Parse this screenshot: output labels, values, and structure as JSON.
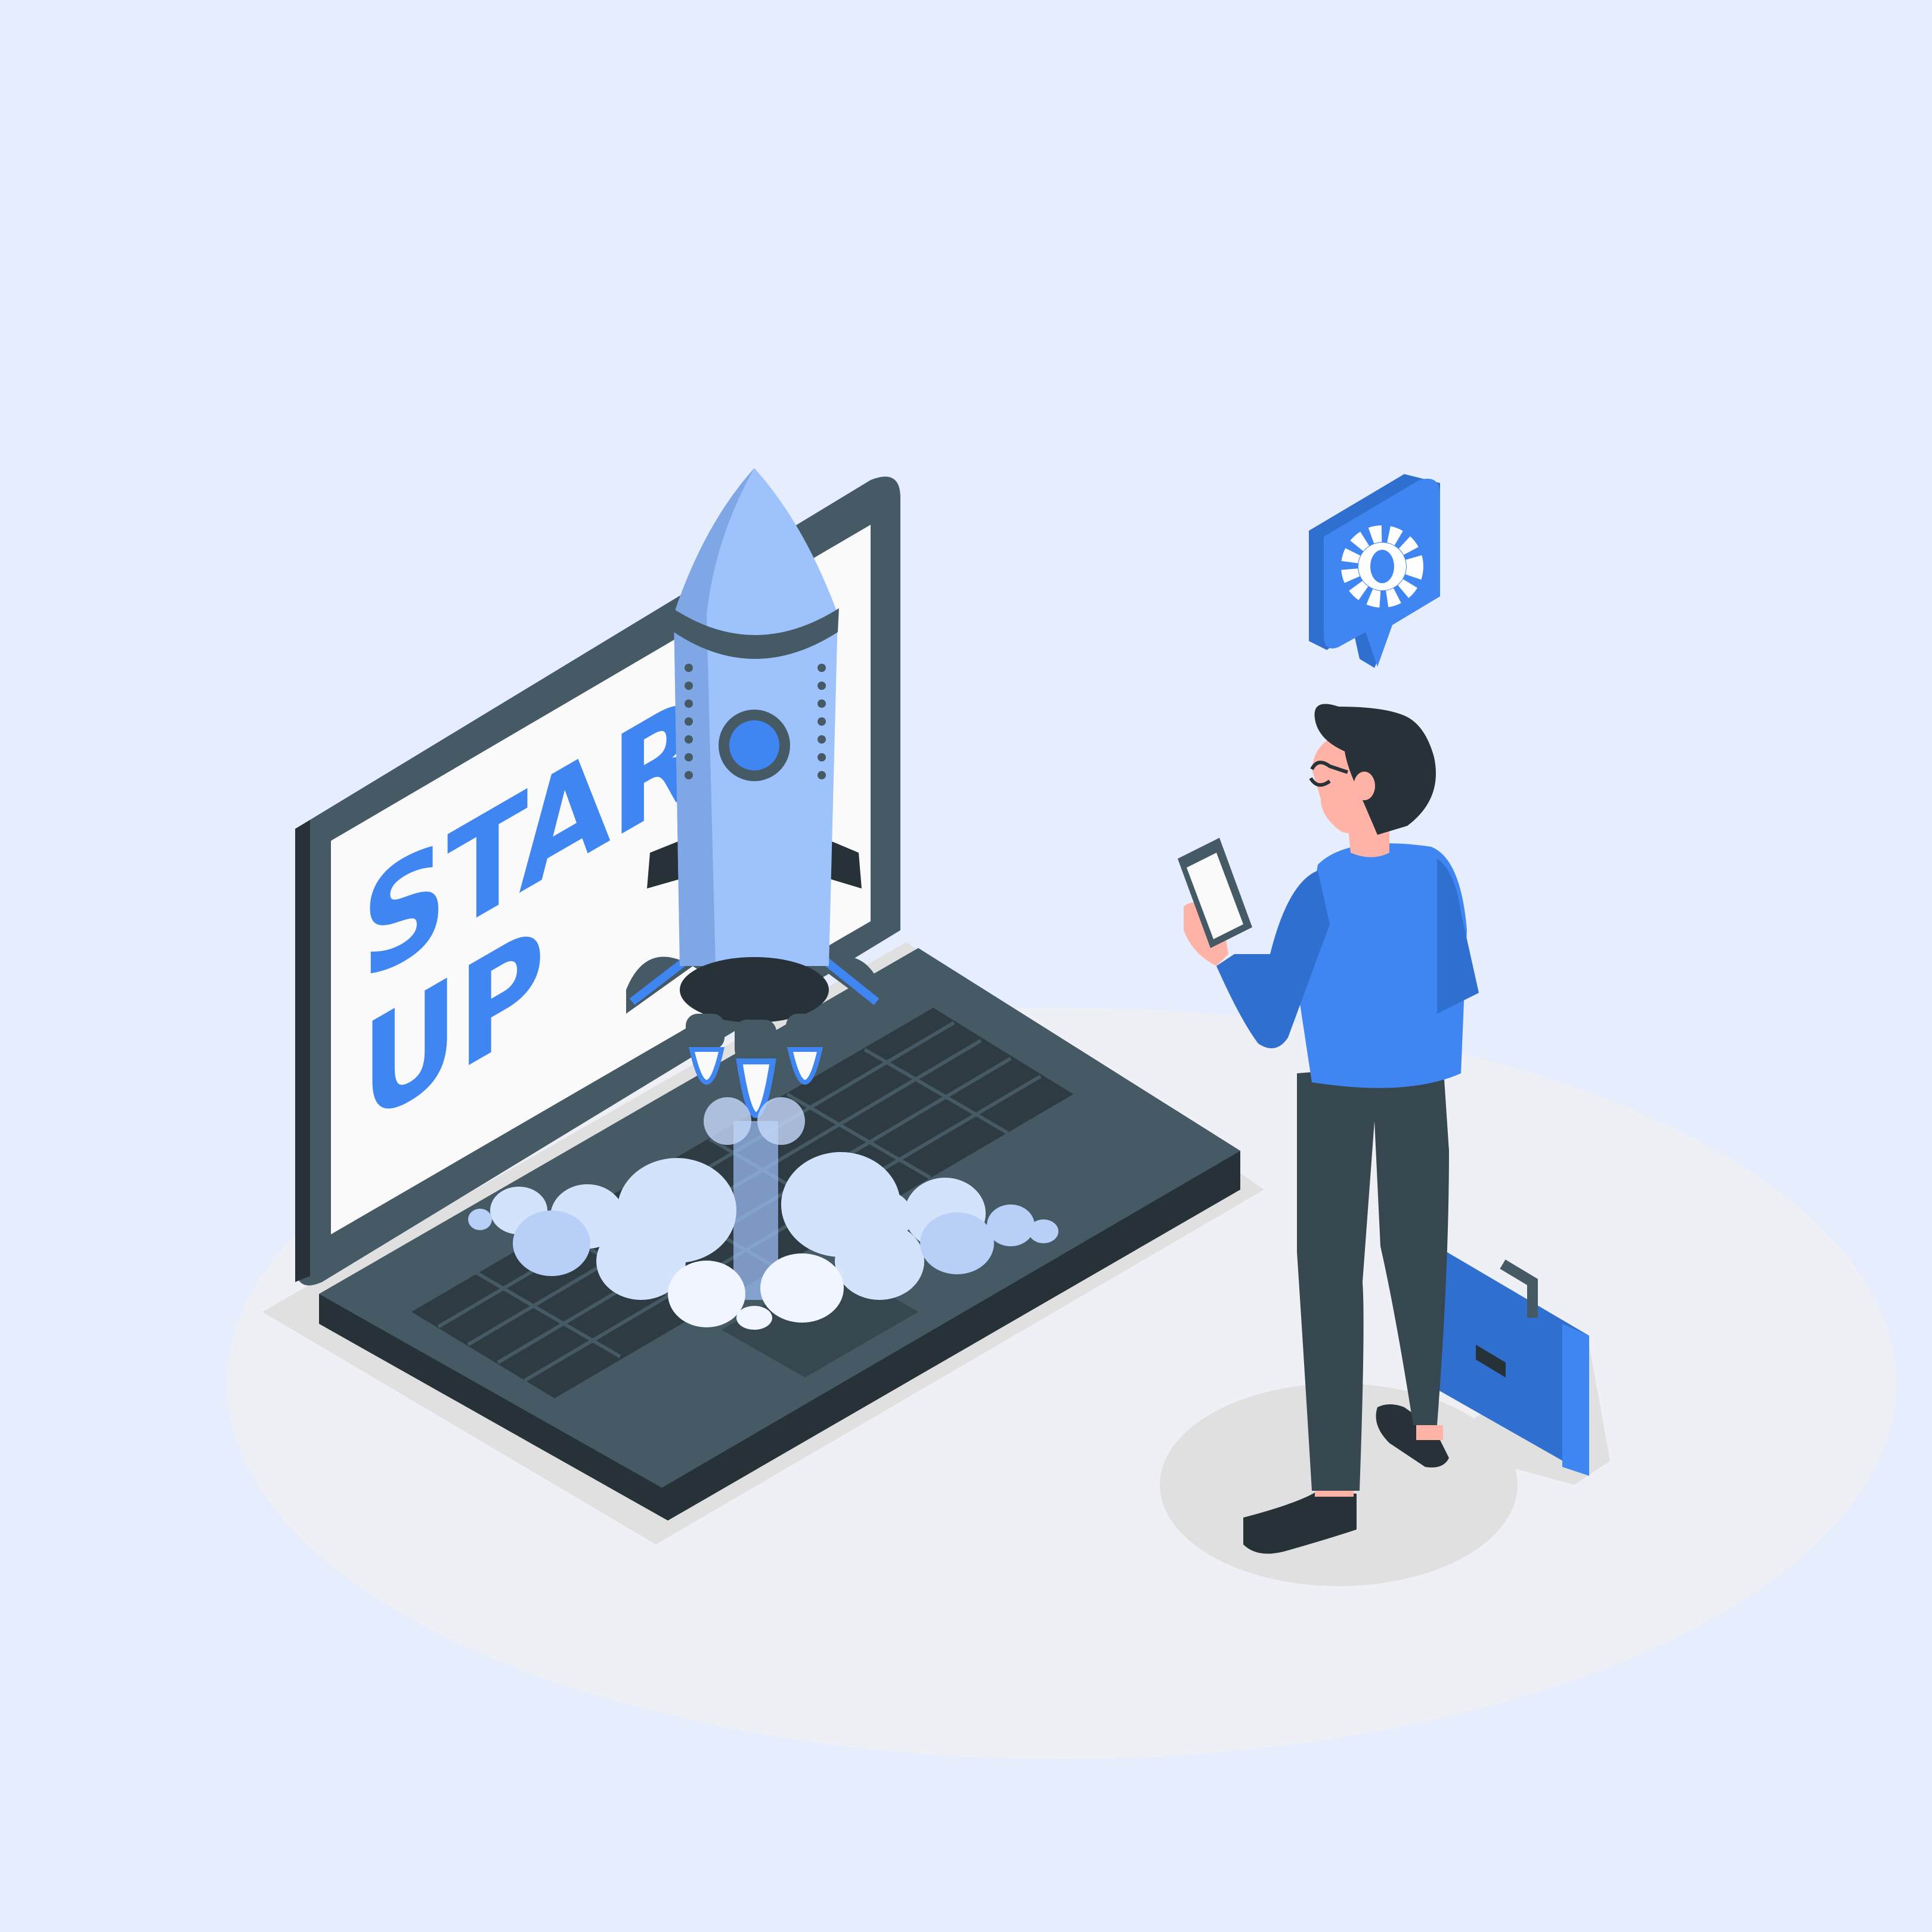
{
  "illustration": {
    "screen_text": {
      "line1": "START",
      "line2": "UP"
    }
  },
  "icons": {
    "rocket": "rocket-icon",
    "settings_bubble": "gear-icon",
    "phone": "phone-icon",
    "briefcase": "briefcase-icon"
  },
  "colors": {
    "background": "#e6edfc",
    "floor": "#eef0f5",
    "accent_blue": "#3f86f2",
    "dark_body": "#455a64",
    "dark_shadow": "#263238",
    "rocket_light": "#9ec2fb",
    "cloud": "#d4e3fc"
  }
}
